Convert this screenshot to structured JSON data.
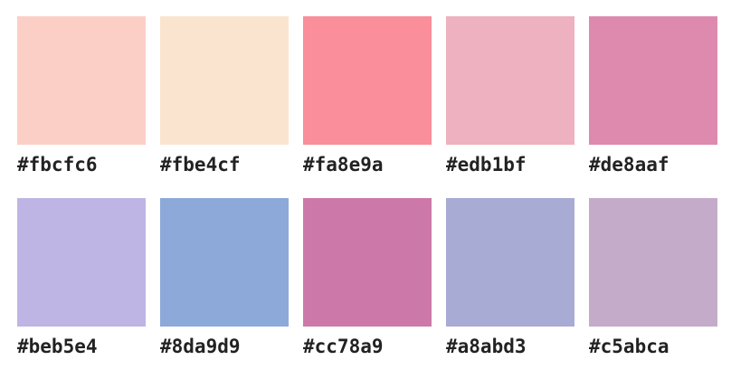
{
  "palette": [
    {
      "label": "#fbcfc6",
      "color": "#fbcfc6"
    },
    {
      "label": "#fbe4cf",
      "color": "#fbe4cf"
    },
    {
      "label": "#fa8e9a",
      "color": "#fa8e9a"
    },
    {
      "label": "#edb1bf",
      "color": "#edb1bf"
    },
    {
      "label": "#de8aaf",
      "color": "#de8aaf"
    },
    {
      "label": "#beb5e4",
      "color": "#beb5e4"
    },
    {
      "label": "#8da9d9",
      "color": "#8da9d9"
    },
    {
      "label": "#cc78a9",
      "color": "#cc78a9"
    },
    {
      "label": "#a8abd3",
      "color": "#a8abd3"
    },
    {
      "label": "#c5abca",
      "color": "#c5abca"
    }
  ]
}
